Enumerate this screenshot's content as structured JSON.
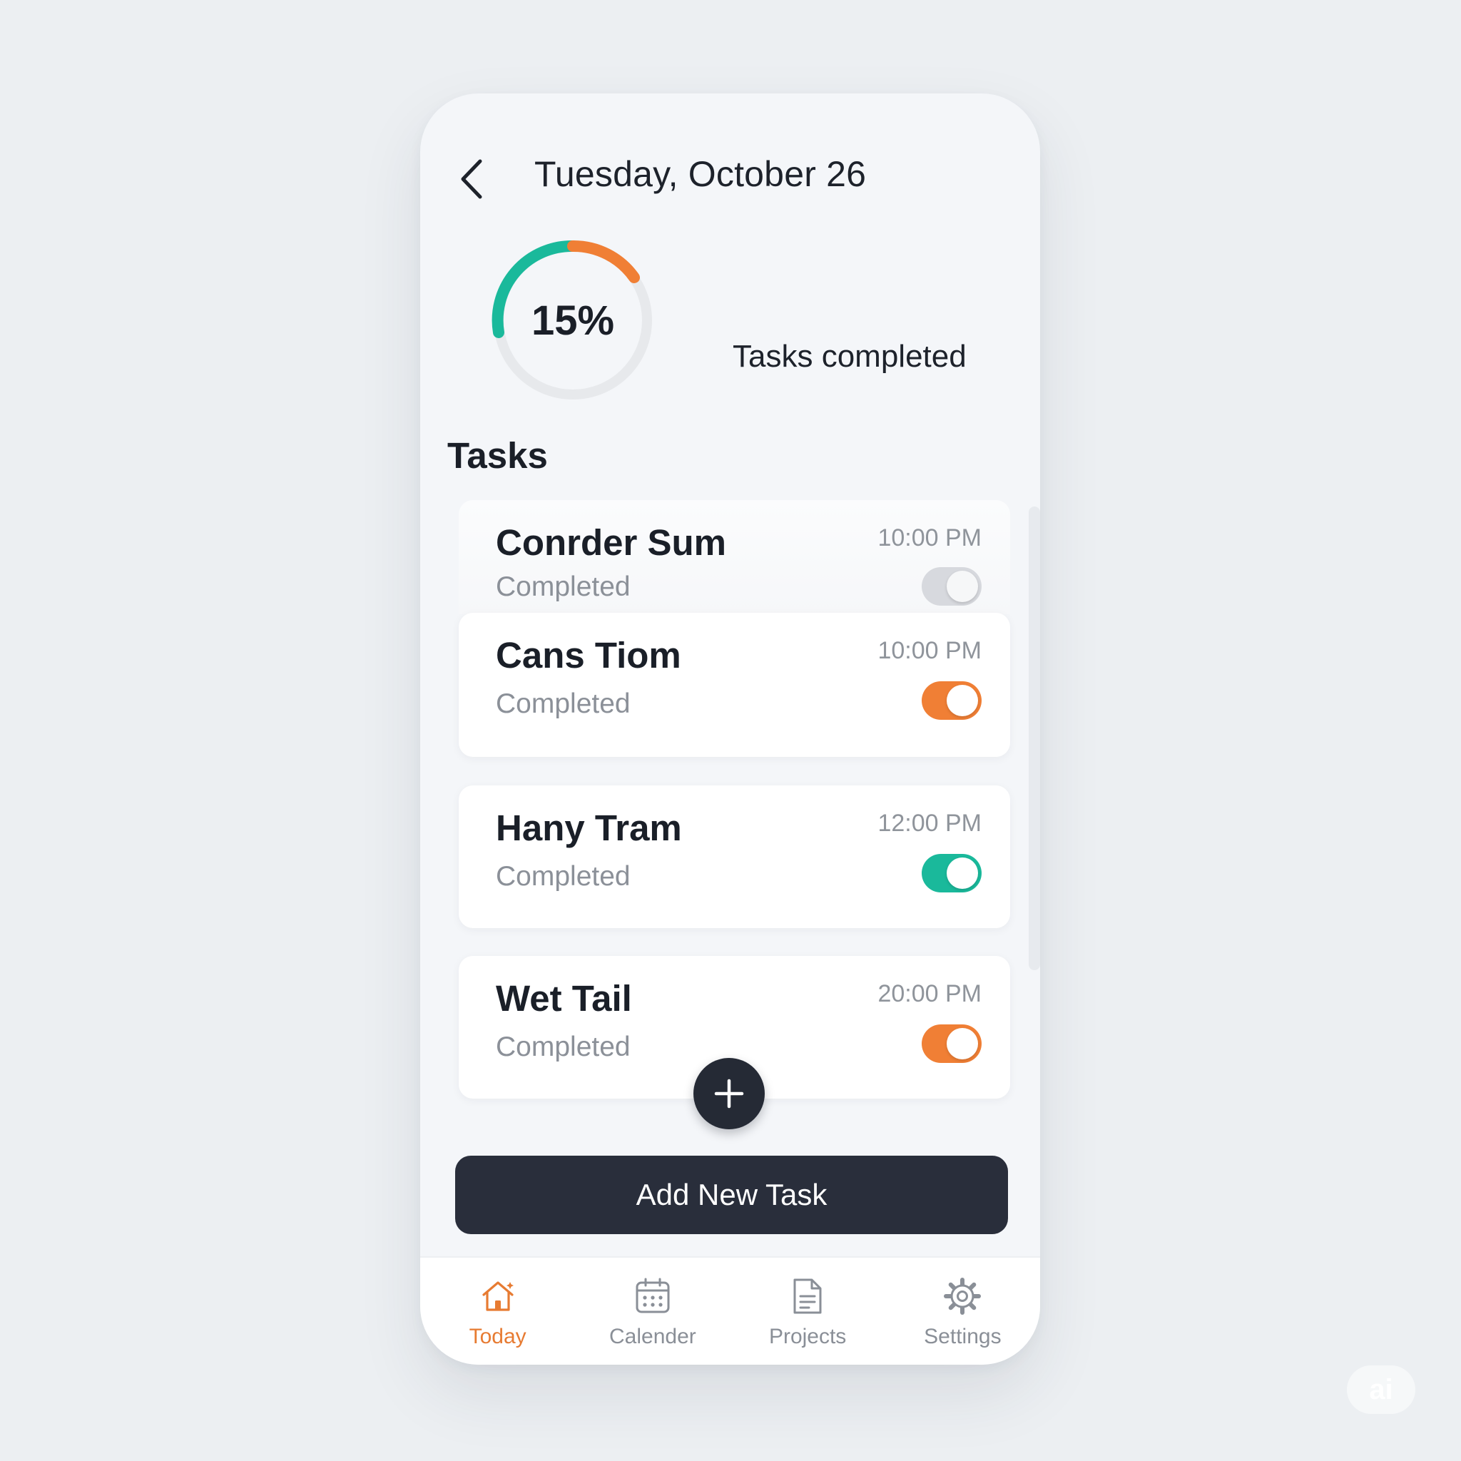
{
  "header": {
    "title": "Tuesday, October 26"
  },
  "progress": {
    "percent_label": "15%",
    "label": "Tasks completed",
    "colors": [
      "#1ab99b",
      "#f07f35"
    ]
  },
  "tasks_section": {
    "title": "Tasks",
    "items": [
      {
        "name": "Conrder Sum",
        "status": "Completed",
        "time": "10:00 PM",
        "toggle_on": false,
        "toggle_color": "#d7d9de"
      },
      {
        "name": "Cans Tiom",
        "status": "Completed",
        "time": "10:00 PM",
        "toggle_on": true,
        "toggle_color": "#f07f35"
      },
      {
        "name": "Hany Tram",
        "status": "Completed",
        "time": "12:00 PM",
        "toggle_on": true,
        "toggle_color": "#1ab99b"
      },
      {
        "name": "Wet Tail",
        "status": "Completed",
        "time": "20:00 PM",
        "toggle_on": true,
        "toggle_color": "#f07f35"
      }
    ]
  },
  "actions": {
    "fab_icon": "plus-icon",
    "add_task_label": "Add New Task"
  },
  "nav": {
    "items": [
      {
        "label": "Today",
        "icon": "home-icon",
        "active": true
      },
      {
        "label": "Calender",
        "icon": "calendar-icon",
        "active": false
      },
      {
        "label": "Projects",
        "icon": "document-icon",
        "active": false
      },
      {
        "label": "Settings",
        "icon": "gear-icon",
        "active": false
      }
    ],
    "active_color": "#e77b32"
  },
  "watermark": {
    "text": "ai"
  }
}
